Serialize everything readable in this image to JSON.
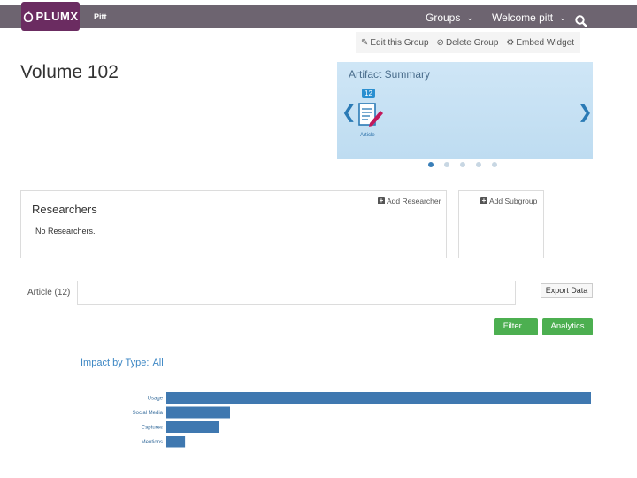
{
  "header": {
    "logo_text": "PLUMX",
    "tenant": "Pitt",
    "groups_label": "Groups",
    "welcome_label": "Welcome pitt"
  },
  "group_actions": {
    "edit": "Edit this Group",
    "delete": "Delete Group",
    "embed": "Embed Widget"
  },
  "page_title": "Volume 102",
  "artifact_summary": {
    "title": "Artifact Summary",
    "items": [
      {
        "label": "Article",
        "count": "12",
        "icon": "article-icon"
      }
    ],
    "carousel_pages": 5,
    "active_page": 0
  },
  "researchers": {
    "title": "Researchers",
    "add_label": "Add Researcher",
    "empty_text": "No Researchers."
  },
  "subgroups": {
    "add_label": "Add Subgroup"
  },
  "artifacts": {
    "tab_label": "Article (12)",
    "export_label": "Export Data",
    "filter_label": "Filter...",
    "analytics_label": "Analytics"
  },
  "impact": {
    "label": "Impact by Type:",
    "value": "All"
  },
  "colors": {
    "header_bg": "#6d6470",
    "logo_bg": "#6b2c61",
    "bar": "#3f78b0",
    "button_green": "#4caf50",
    "link_blue": "#3d87c4"
  },
  "chart_data": {
    "type": "bar",
    "orientation": "horizontal",
    "categories": [
      "Usage",
      "Social Media",
      "Captures",
      "Mentions"
    ],
    "values": [
      100,
      15,
      12.5,
      4.4
    ],
    "xlim": [
      0,
      100
    ]
  }
}
